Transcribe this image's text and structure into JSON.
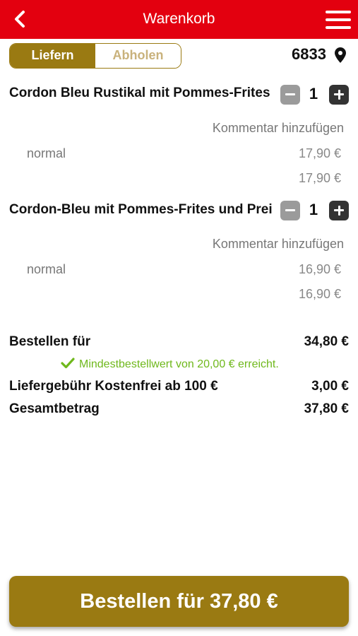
{
  "header": {
    "title": "Warenkorb"
  },
  "delivery_toggle": {
    "option_delivery": "Liefern",
    "option_pickup": "Abholen",
    "selected": "Liefern"
  },
  "location": {
    "postal_code": "6833"
  },
  "items": [
    {
      "name": "Cordon Bleu Rustikal mit Pommes-Frites u",
      "quantity": "1",
      "comment_link": "Kommentar hinzufügen",
      "variant": "normal",
      "variant_price": "17,90 €",
      "total": "17,90 €"
    },
    {
      "name": "Cordon-Bleu mit Pommes-Frites und Preis",
      "quantity": "1",
      "comment_link": "Kommentar hinzufügen",
      "variant": "normal",
      "variant_price": "16,90 €",
      "total": "16,90 €"
    }
  ],
  "summary": {
    "subtotal_label": "Bestellen für",
    "subtotal_value": "34,80 €",
    "min_order_note": "Mindestbestellwert von 20,00 € erreicht.",
    "delivery_fee_label": "Liefergebühr Kostenfrei ab 100 €",
    "delivery_fee_value": "3,00 €",
    "total_label": "Gesamtbetrag",
    "total_value": "37,80 €"
  },
  "order_button": {
    "label": "Bestellen für 37,80 €"
  },
  "colors": {
    "header": "#e3000f",
    "accent": "#9a7a12",
    "success": "#6fb81c"
  }
}
